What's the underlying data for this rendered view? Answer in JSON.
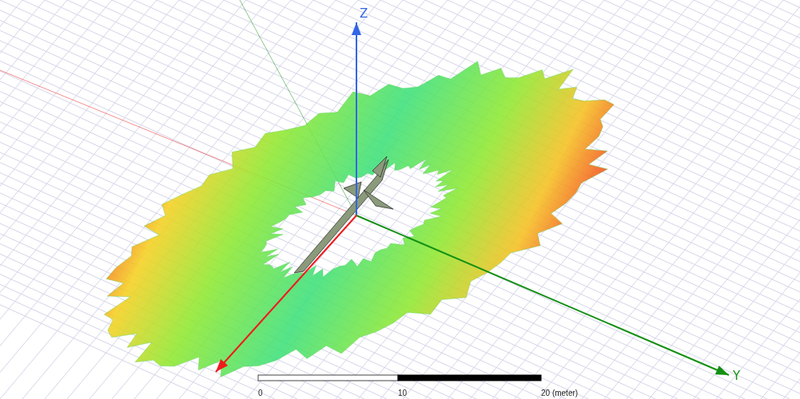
{
  "axes": [
    {
      "kind": "z",
      "label": "Z",
      "color": "#3366e6"
    },
    {
      "kind": "y",
      "label": "Y",
      "color": "#139013"
    },
    {
      "kind": "x",
      "color": "#ee1c1c"
    }
  ],
  "scale_bar": {
    "ticks": [
      "0",
      "10",
      "20 (meter)"
    ]
  }
}
